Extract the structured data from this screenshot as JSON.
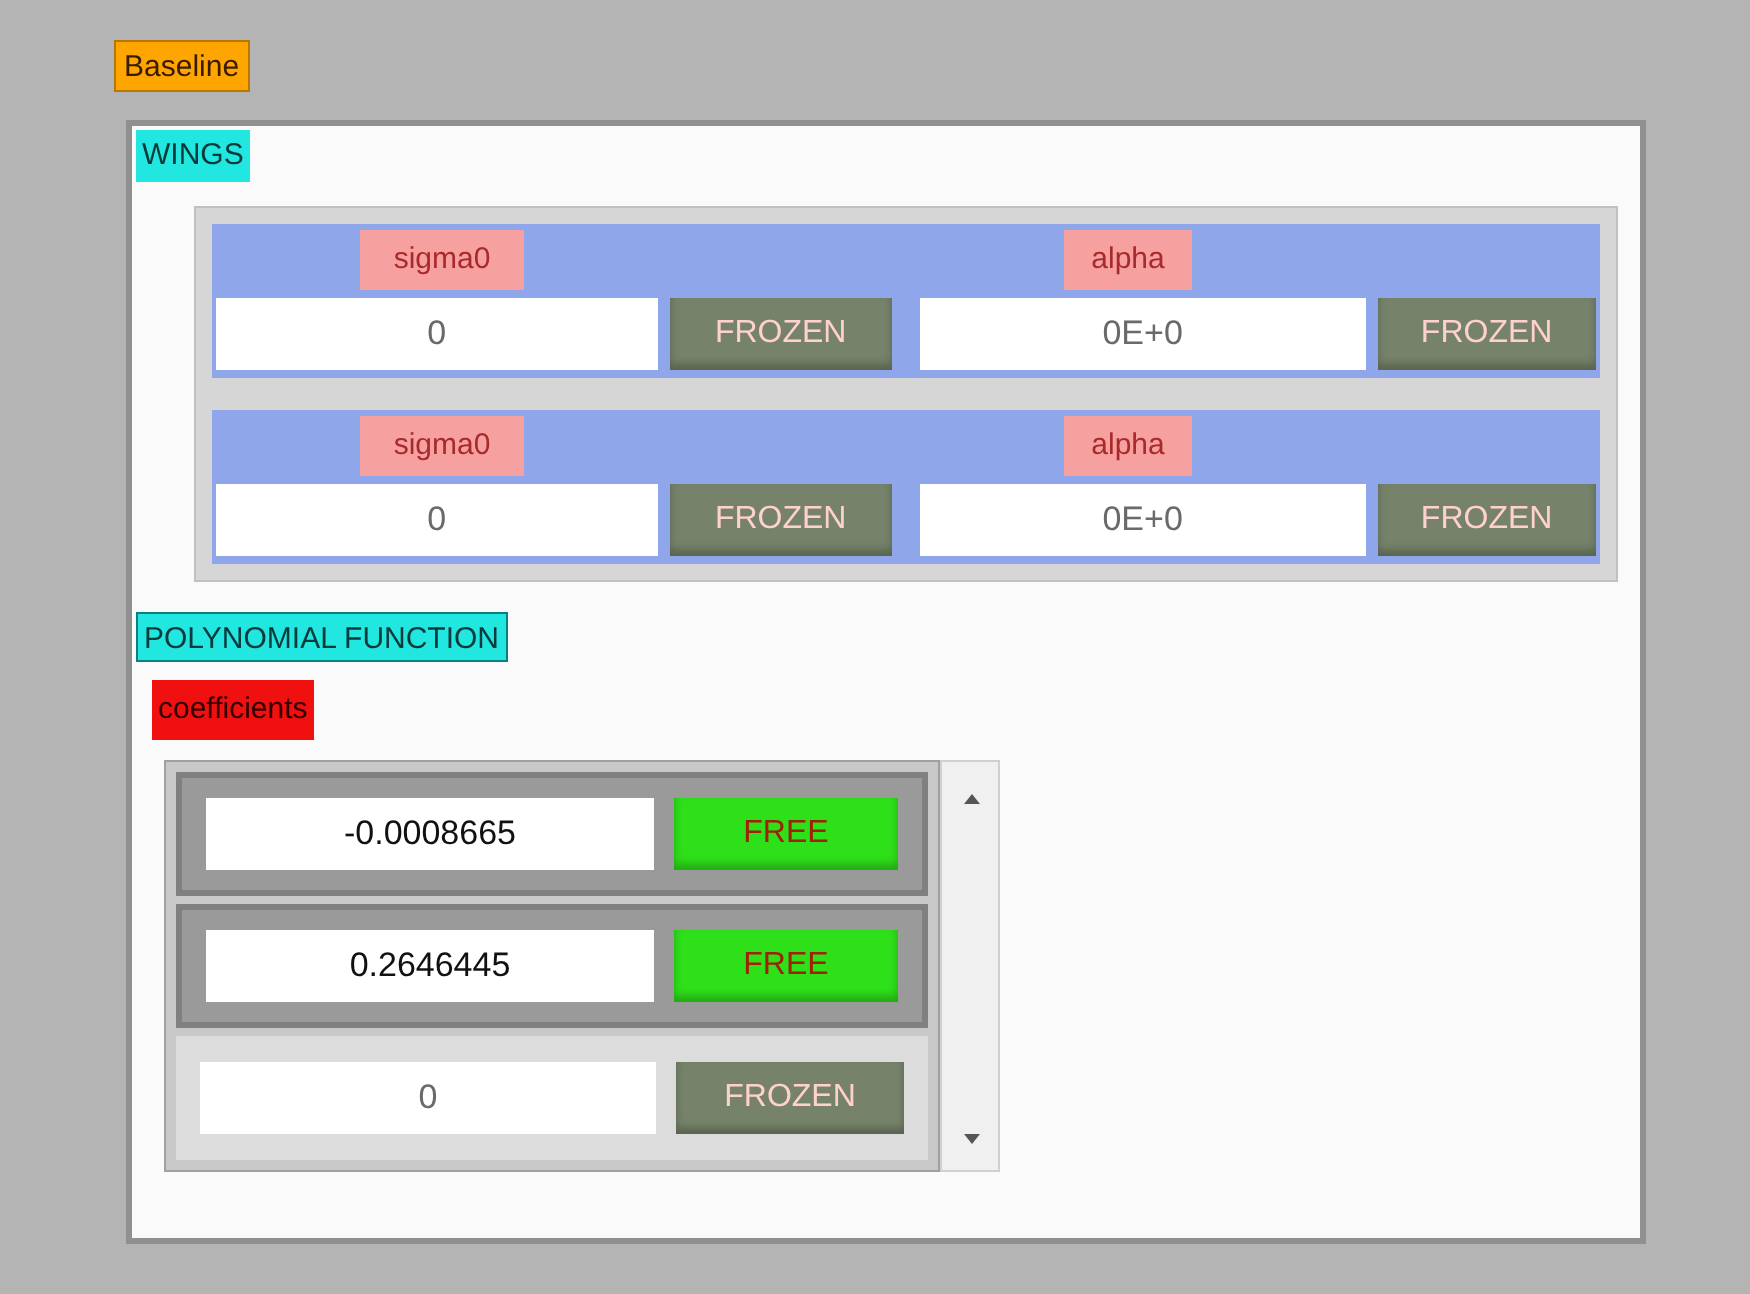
{
  "cluster_label": "Baseline",
  "wings": {
    "label": "WINGS",
    "rows": [
      {
        "sigma_label": "sigma0",
        "sigma_value": "0",
        "sigma_button": "FROZEN",
        "alpha_label": "alpha",
        "alpha_value": "0E+0",
        "alpha_button": "FROZEN",
        "disabled": true
      },
      {
        "sigma_label": "sigma0",
        "sigma_value": "0",
        "sigma_button": "FROZEN",
        "alpha_label": "alpha",
        "alpha_value": "0E+0",
        "alpha_button": "FROZEN",
        "disabled": true
      }
    ]
  },
  "polynomial": {
    "label": "POLYNOMIAL FUNCTION",
    "array_label": "coefficients",
    "rows": [
      {
        "value": "-0.0008665",
        "button": "FREE",
        "disabled": false
      },
      {
        "value": "0.2646445",
        "button": "FREE",
        "disabled": false
      },
      {
        "value": "0",
        "button": "FROZEN",
        "disabled": true
      }
    ]
  }
}
